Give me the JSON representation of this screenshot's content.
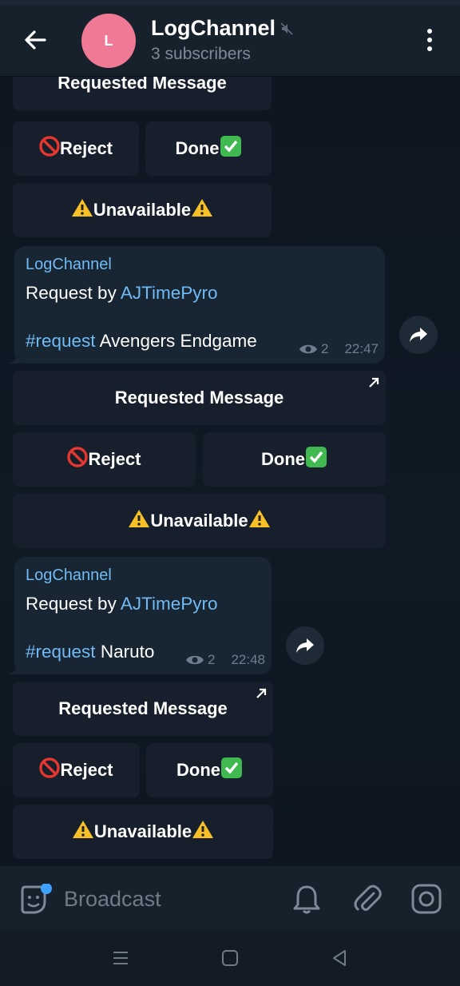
{
  "header": {
    "back_icon": "arrow-left-icon",
    "avatar_letter": "L",
    "avatar_color": "#f07a95",
    "title": "LogChannel",
    "subtitle": "3 subscribers",
    "mute_icon": "speaker-muted-icon",
    "menu_icon": "more-vertical-icon"
  },
  "messages": [
    {
      "keyboard": {
        "requested": "Requested Message",
        "reject": "Reject",
        "done": "Done",
        "unavailable": "Unavailable"
      }
    },
    {
      "author": "LogChannel",
      "request_prefix": "Request by ",
      "requester": "AJTimePyro",
      "hashtag": "#request",
      "title": " Avengers Endgame",
      "views": "2",
      "time": "22:47",
      "keyboard": {
        "requested": "Requested Message",
        "reject": "Reject",
        "done": "Done",
        "unavailable": "Unavailable"
      }
    },
    {
      "author": "LogChannel",
      "request_prefix": "Request by ",
      "requester": "AJTimePyro",
      "hashtag": "#request",
      "title": " Naruto",
      "views": "2",
      "time": "22:48",
      "keyboard": {
        "requested": "Requested Message",
        "reject": "Reject",
        "done": "Done",
        "unavailable": "Unavailable"
      }
    }
  ],
  "composer": {
    "placeholder": "Broadcast",
    "icons": [
      "sticker-icon",
      "bell-icon",
      "paperclip-icon",
      "camera-icon"
    ]
  },
  "colors": {
    "link": "#71baf4",
    "bubble": "#182533",
    "button": "#161f2b",
    "background": "#0e1621"
  }
}
